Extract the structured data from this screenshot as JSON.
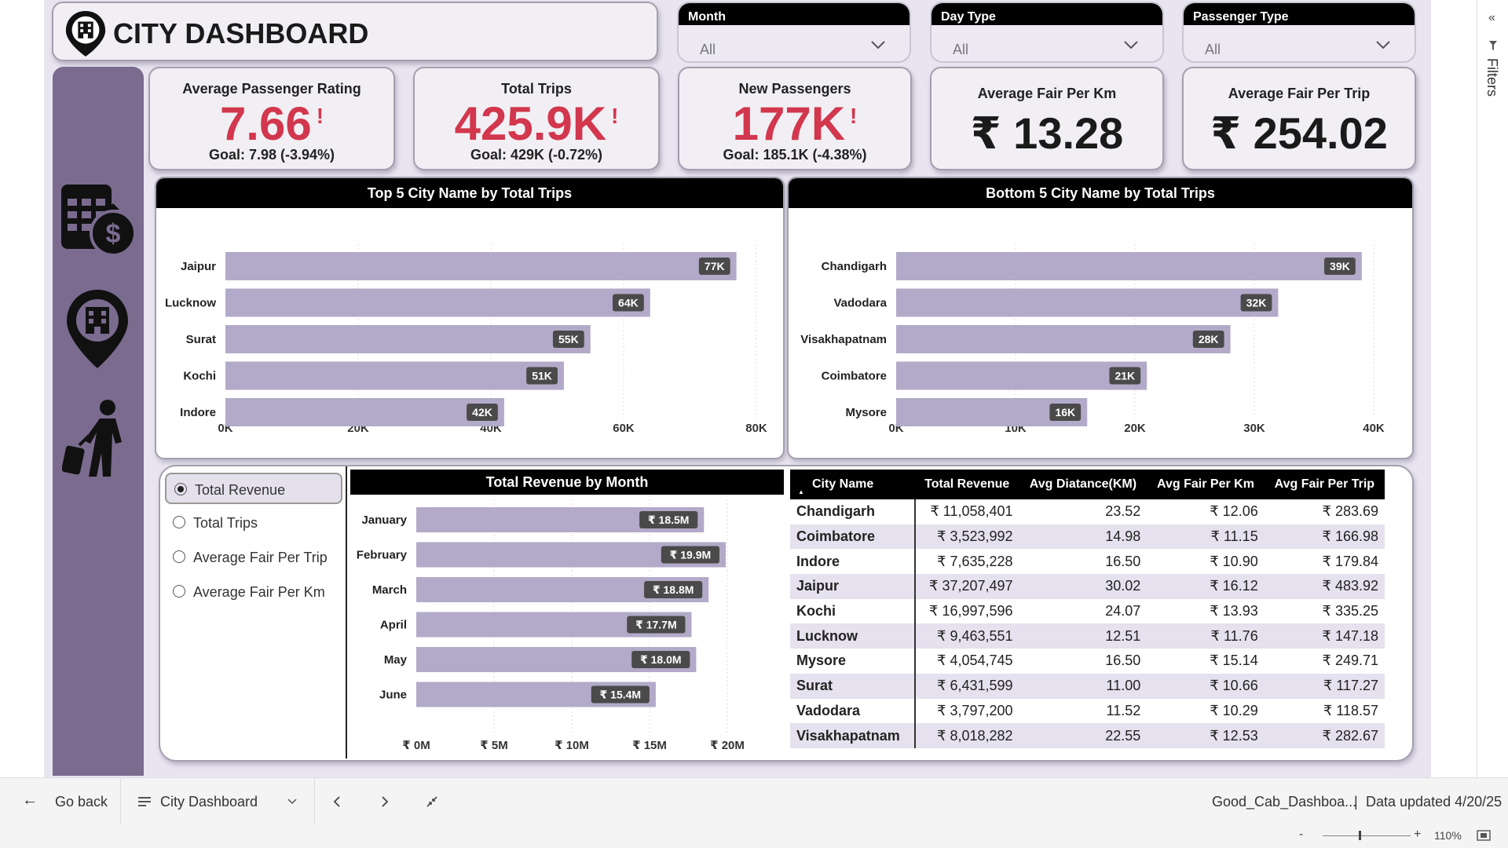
{
  "title": "CITY DASHBOARD",
  "slicers": [
    {
      "label": "Month",
      "value": "All"
    },
    {
      "label": "Day Type",
      "value": "All"
    },
    {
      "label": "Passenger Type",
      "value": "All"
    }
  ],
  "kpis_goal": [
    {
      "label": "Average Passenger Rating",
      "value": "7.66",
      "goal": "Goal: 7.98 (-3.94%)"
    },
    {
      "label": "Total Trips",
      "value": "425.9K",
      "goal": "Goal: 429K (-0.72%)"
    },
    {
      "label": "New Passengers",
      "value": "177K",
      "goal": "Goal: 185.1K (-4.38%)"
    }
  ],
  "kpis_plain": [
    {
      "label": "Average Fair Per Km",
      "value": "₹ 13.28"
    },
    {
      "label": "Average Fair Per Trip",
      "value": "₹ 254.02"
    }
  ],
  "alert_mark": "!",
  "colors": {
    "accent_red": "#d2374d",
    "bar": "#b2aac8",
    "rail": "#7a6b8f",
    "page_bg": "#e8e4f0"
  },
  "icons": [
    "revenue-calendar-icon",
    "city-pin-icon",
    "traveler-icon"
  ],
  "chart_data": [
    {
      "type": "bar",
      "orientation": "horizontal",
      "title": "Top 5 City Name by Total Trips",
      "categories": [
        "Jaipur",
        "Lucknow",
        "Surat",
        "Kochi",
        "Indore"
      ],
      "values": [
        77000,
        64000,
        55000,
        51000,
        42000
      ],
      "data_labels": [
        "77K",
        "64K",
        "55K",
        "51K",
        "42K"
      ],
      "xlim": [
        0,
        80000
      ],
      "xticks": [
        "0K",
        "20K",
        "40K",
        "60K",
        "80K"
      ],
      "grid": true
    },
    {
      "type": "bar",
      "orientation": "horizontal",
      "title": "Bottom 5 City Name by Total Trips",
      "categories": [
        "Chandigarh",
        "Vadodara",
        "Visakhapatnam",
        "Coimbatore",
        "Mysore"
      ],
      "values": [
        39000,
        32000,
        28000,
        21000,
        16000
      ],
      "data_labels": [
        "39K",
        "32K",
        "28K",
        "21K",
        "16K"
      ],
      "xlim": [
        0,
        40000
      ],
      "xticks": [
        "0K",
        "10K",
        "20K",
        "30K",
        "40K"
      ],
      "grid": true
    },
    {
      "type": "bar",
      "orientation": "horizontal",
      "title": "Total Revenue by Month",
      "categories": [
        "January",
        "February",
        "March",
        "April",
        "May",
        "June"
      ],
      "values": [
        18.5,
        19.9,
        18.8,
        17.7,
        18.0,
        15.4
      ],
      "data_labels": [
        "₹ 18.5M",
        "₹ 19.9M",
        "₹ 18.8M",
        "₹ 17.7M",
        "₹ 18.0M",
        "₹ 15.4M"
      ],
      "xlim": [
        0,
        20
      ],
      "xticks": [
        "₹ 0M",
        "₹ 5M",
        "₹ 10M",
        "₹ 15M",
        "₹ 20M"
      ],
      "grid": true
    }
  ],
  "measure_options": [
    {
      "label": "Total Revenue",
      "selected": true
    },
    {
      "label": "Total Trips",
      "selected": false
    },
    {
      "label": "Average Fair Per Trip",
      "selected": false
    },
    {
      "label": "Average Fair Per Km",
      "selected": false
    }
  ],
  "table": {
    "columns": [
      "City Name",
      "Total Revenue",
      "Avg Diatance(KM)",
      "Avg Fair Per Km",
      "Avg Fair Per Trip"
    ],
    "rows": [
      [
        "Chandigarh",
        "₹ 11,058,401",
        "23.52",
        "₹ 12.06",
        "₹ 283.69"
      ],
      [
        "Coimbatore",
        "₹ 3,523,992",
        "14.98",
        "₹ 11.15",
        "₹ 166.98"
      ],
      [
        "Indore",
        "₹ 7,635,228",
        "16.50",
        "₹ 10.90",
        "₹ 179.84"
      ],
      [
        "Jaipur",
        "₹ 37,207,497",
        "30.02",
        "₹ 16.12",
        "₹ 483.92"
      ],
      [
        "Kochi",
        "₹ 16,997,596",
        "24.07",
        "₹ 13.93",
        "₹ 335.25"
      ],
      [
        "Lucknow",
        "₹ 9,463,551",
        "12.51",
        "₹ 11.76",
        "₹ 147.18"
      ],
      [
        "Mysore",
        "₹ 4,054,745",
        "16.50",
        "₹ 15.14",
        "₹ 249.71"
      ],
      [
        "Surat",
        "₹ 6,431,599",
        "11.00",
        "₹ 10.66",
        "₹ 117.27"
      ],
      [
        "Vadodara",
        "₹ 3,797,200",
        "11.52",
        "₹ 10.29",
        "₹ 118.57"
      ],
      [
        "Visakhapatnam",
        "₹ 8,018,282",
        "22.55",
        "₹ 12.53",
        "₹ 282.67"
      ]
    ]
  },
  "statusbar": {
    "go_back": "Go back",
    "page_name": "City Dashboard",
    "file_name": "Good_Cab_Dashboa...",
    "separator": "|",
    "updated": "Data updated 4/20/25",
    "zoom": "110%",
    "zoom_minus": "-",
    "zoom_plus": "+"
  },
  "filters_pane": {
    "label": "Filters",
    "collapse_glyph": "«"
  }
}
